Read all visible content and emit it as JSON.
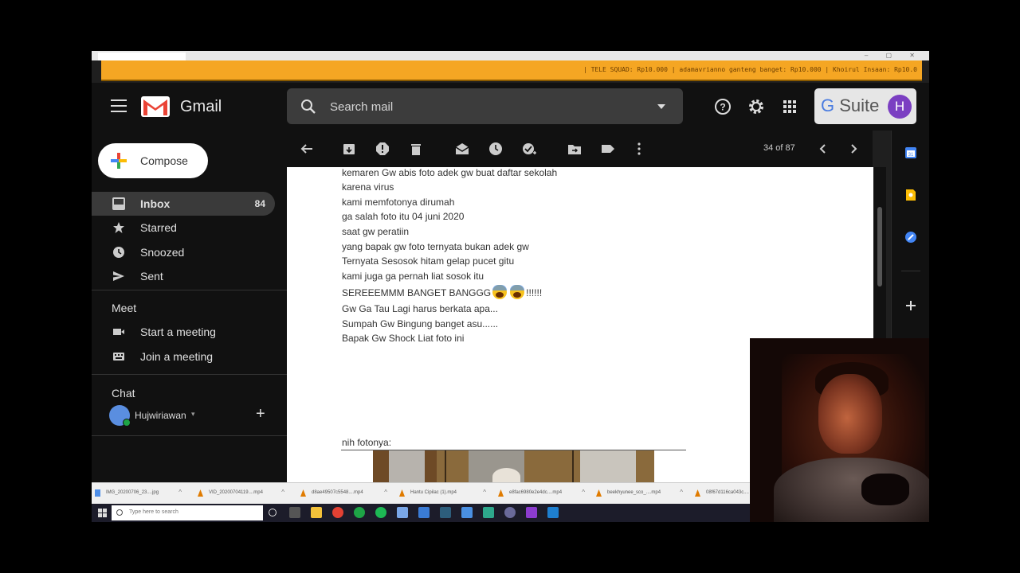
{
  "ticker": {
    "text": "| TELE SQUAD: Rp10.000 | adamavrianno ganteng banget: Rp10.000 | Khoirul Insaan: Rp10.0"
  },
  "header": {
    "app_name": "Gmail",
    "search_placeholder": "Search mail",
    "gsuite_label_g": "G",
    "gsuite_label_rest": " Suite",
    "avatar_letter": "H"
  },
  "sidebar": {
    "compose_label": "Compose",
    "items": [
      {
        "label": "Inbox",
        "count": "84",
        "icon": "inbox-icon",
        "active": true
      },
      {
        "label": "Starred",
        "count": "",
        "icon": "star-icon",
        "active": false
      },
      {
        "label": "Snoozed",
        "count": "",
        "icon": "clock-icon",
        "active": false
      },
      {
        "label": "Sent",
        "count": "",
        "icon": "send-icon",
        "active": false
      }
    ],
    "meet": {
      "heading": "Meet",
      "items": [
        {
          "label": "Start a meeting",
          "icon": "video-icon"
        },
        {
          "label": "Join a meeting",
          "icon": "keyboard-icon"
        }
      ]
    },
    "chat": {
      "heading": "Chat",
      "user": "Hujwiriawan",
      "add": "+"
    }
  },
  "toolbar": {
    "pager": "34 of 87"
  },
  "email": {
    "lines": [
      "kemaren Gw abis foto adek gw buat daftar sekolah",
      "karena  virus",
      "kami memfotonya dirumah",
      "ga salah foto itu 04 juni 2020",
      "saat gw peratiin",
      "yang bapak gw foto ternyata bukan adek gw",
      "Ternyata Sesosok hitam gelap pucet gitu",
      "kami juga ga pernah liat sosok itu"
    ],
    "shout_line": "SEREEEMMM BANGET BANGGG",
    "shout_suffix": "!!!!!!",
    "lines2": [
      "Gw Ga Tau Lagi harus berkata apa...",
      "Sumpah Gw Bingung banget asu......",
      "Bapak Gw Shock Liat foto ini"
    ],
    "attachment_caption": "nih fotonya:"
  },
  "downloads": [
    {
      "name": "IMG_20200706_23....jpg"
    },
    {
      "name": "VID_20200704119....mp4"
    },
    {
      "name": "d8ae49507c5548....mp4"
    },
    {
      "name": "Hantu Cipilac (1).mp4"
    },
    {
      "name": "e8fac6980e2e4dc....mp4"
    },
    {
      "name": "beekhyunee_sco_....mp4"
    },
    {
      "name": "08f67d116ca043c...."
    }
  ],
  "taskbar": {
    "search_placeholder": "Type here to search"
  },
  "colors": {
    "ticker_bg": "#f5a623",
    "gmail_red": "#ea4335",
    "avatar_purple": "#7b3fc2"
  }
}
